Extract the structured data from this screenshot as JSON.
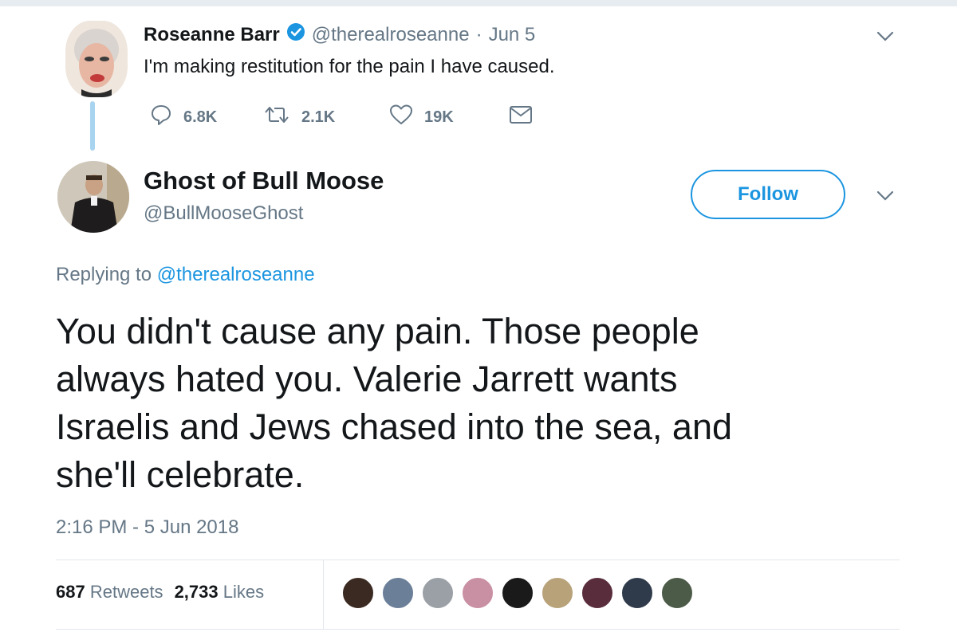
{
  "original_tweet": {
    "author_name": "Roseanne Barr",
    "handle": "@therealroseanne",
    "separator": "·",
    "date": "Jun 5",
    "text": "I'm making restitution for the pain I have caused.",
    "replies": "6.8K",
    "retweets": "2.1K",
    "likes": "19K",
    "verified": true,
    "icons": [
      "reply-icon",
      "retweet-icon",
      "like-icon",
      "dm-icon",
      "chevron-down-icon",
      "verified-badge-icon"
    ]
  },
  "reply_tweet": {
    "author_name": "Ghost of Bull Moose",
    "handle": "@BullMooseGhost",
    "follow_label": "Follow",
    "replying_prefix": "Replying to",
    "replying_handle": "@therealroseanne",
    "text_lines": [
      "You didn't cause any pain. Those people",
      "always hated you. Valerie Jarrett wants",
      "Israelis and Jews chased into the sea, and",
      "she'll celebrate."
    ],
    "timestamp": "2:16 PM - 5 Jun 2018",
    "retweet_count": "687",
    "retweet_label": "Retweets",
    "like_count": "2,733",
    "like_label": "Likes"
  },
  "colors": {
    "accent": "#1b95e0",
    "muted": "#657786",
    "text": "#14171a",
    "thread_line": "#a9d4f0"
  },
  "liker_avatars": [
    {
      "color": "#3b2a22"
    },
    {
      "color": "#6b7f99"
    },
    {
      "color": "#9aa0a6"
    },
    {
      "color": "#c98fa3"
    },
    {
      "color": "#1a1a1a"
    },
    {
      "color": "#b8a27a"
    },
    {
      "color": "#5a2d3c"
    },
    {
      "color": "#2f3b4a"
    },
    {
      "color": "#4c5a48"
    }
  ]
}
